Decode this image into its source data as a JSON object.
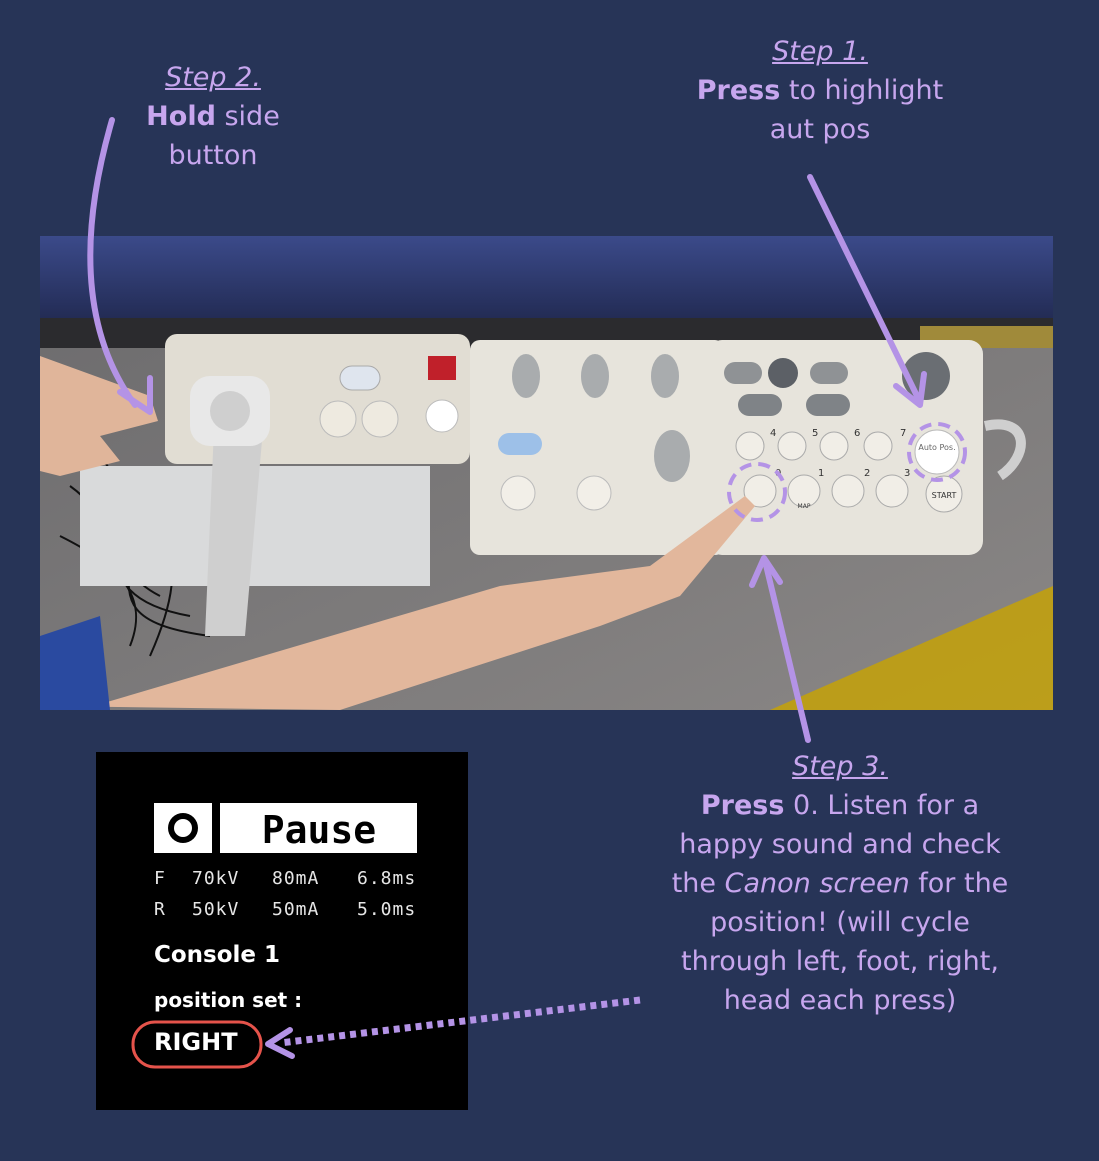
{
  "step1": {
    "title": "Step 1.",
    "verb": "Press",
    "rest_line1": " to highlight",
    "rest_line2": "aut pos"
  },
  "step2": {
    "title": "Step 2.",
    "verb": "Hold",
    "rest_line1": " side",
    "rest_line2": "button"
  },
  "step3": {
    "title": "Step 3.",
    "verb": "Press",
    "line1_rest": " 0. Listen for a",
    "line2": "happy sound and check",
    "line3_pre": "the ",
    "line3_em": "Canon screen",
    "line3_post": " for the",
    "line4": "position! (will cycle",
    "line5": "through left, foot, right,",
    "line6": "head each press)"
  },
  "console_panel": {
    "button_labels": {
      "auto_pos": "Auto Pos.",
      "start": "START",
      "map": "MAP",
      "num_0": "0",
      "num_1": "1",
      "num_2": "2",
      "num_3": "3",
      "num_4": "4",
      "num_5": "5",
      "num_6": "6",
      "num_7": "7"
    }
  },
  "canon_screen": {
    "status": "Pause",
    "readouts": [
      {
        "mode": "F",
        "kv": "70kV",
        "ma": "80mA",
        "ms": "6.8ms"
      },
      {
        "mode": "R",
        "kv": "50kV",
        "ma": "50mA",
        "ms": "5.0ms"
      }
    ],
    "console": "Console 1",
    "position_label": "position set :",
    "position_value": "RIGHT"
  },
  "colors": {
    "background": "#273457",
    "accent": "#c7a6ee",
    "highlight_red": "#e5534b"
  }
}
